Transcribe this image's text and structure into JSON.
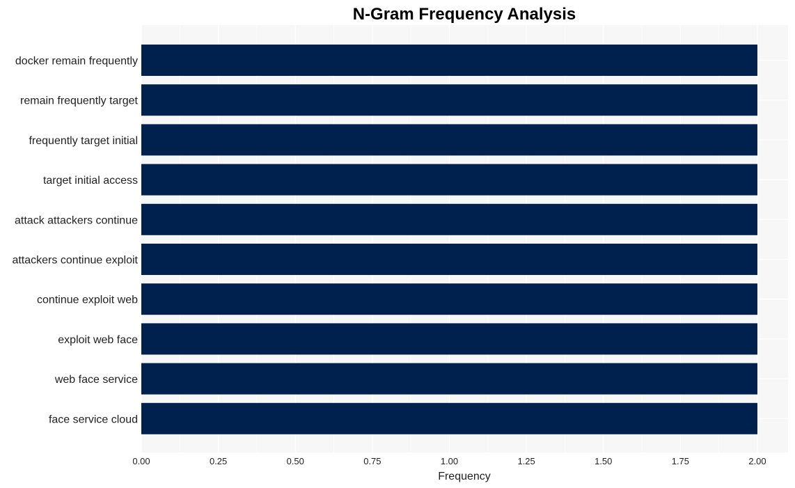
{
  "chart_data": {
    "type": "bar",
    "orientation": "horizontal",
    "title": "N-Gram Frequency Analysis",
    "xlabel": "Frequency",
    "ylabel": "",
    "categories": [
      "docker remain frequently",
      "remain frequently target",
      "frequently target initial",
      "target initial access",
      "attack attackers continue",
      "attackers continue exploit",
      "continue exploit web",
      "exploit web face",
      "web face service",
      "face service cloud"
    ],
    "values": [
      2,
      2,
      2,
      2,
      2,
      2,
      2,
      2,
      2,
      2
    ],
    "xlim": [
      0,
      2.1
    ],
    "xticks": [
      "0.00",
      "0.25",
      "0.50",
      "0.75",
      "1.00",
      "1.25",
      "1.50",
      "1.75",
      "2.00"
    ],
    "grid": true,
    "legend": "none",
    "colors": {
      "bar": "#00204e",
      "plot_background": "#f7f7f7",
      "grid": "#ffffff"
    }
  }
}
